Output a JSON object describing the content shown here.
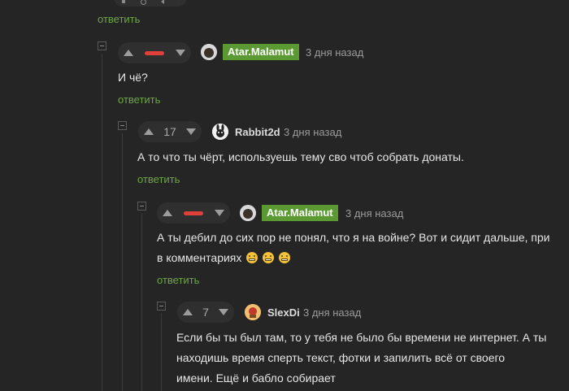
{
  "comments": [
    {
      "author": "Atar.Malamut",
      "author_badge": true,
      "time": "3 дня назад",
      "rating": "negative",
      "text": "И чё?",
      "reply": "ответить"
    },
    {
      "author": "Rabbit2d",
      "author_badge": false,
      "time": "3 дня назад",
      "rating": "17",
      "text": "А то что ты чёрт, используешь тему сво чтоб собрать донаты.",
      "reply": "ответить"
    },
    {
      "author": "Atar.Malamut",
      "author_badge": true,
      "time": "3 дня назад",
      "rating": "negative",
      "text_line1": "А ты дебил до сих пор не понял, что я на войне? Вот и сидит дальше, при",
      "text_line2": "в комментариях",
      "emojis": [
        "grimacing-emoji",
        "grimacing-emoji",
        "grimacing-emoji"
      ],
      "reply": "ответить"
    },
    {
      "author": "SlexDi",
      "author_badge": false,
      "time": "3 дня назад",
      "rating": "7",
      "text_line1": "Если бы ты был там, то у тебя не было бы времени не интернет. А ты",
      "text_line2": "находишь время сперть текст, фотки и запилить всё от своего",
      "text_line3": "имени. Ещё и бабло собирает"
    }
  ],
  "top_reply": "ответить",
  "colors": {
    "background": "#252525",
    "reply_link": "#6ea548",
    "author_badge": "#5b9a33",
    "negative_rating": "#e0403a"
  }
}
